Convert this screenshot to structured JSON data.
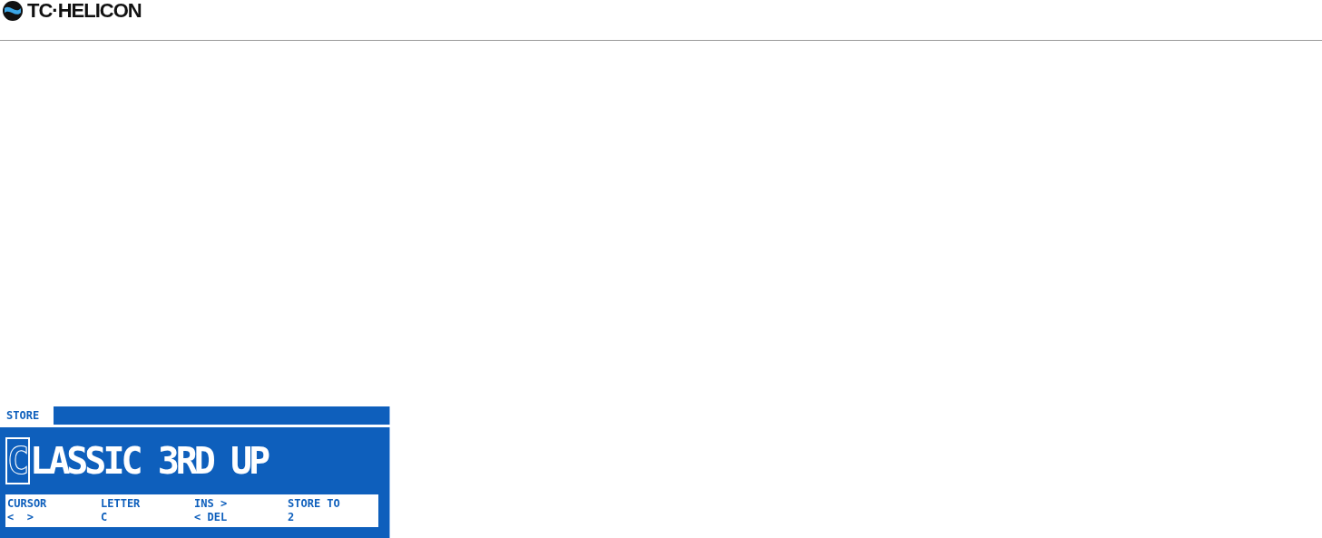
{
  "header": {
    "logo_text": "TC·HELICON"
  },
  "display": {
    "tab": "STORE",
    "name": {
      "selected_part": "C",
      "rest": "LASSIC 3RD UP"
    },
    "columns": [
      {
        "label": "CURSOR",
        "value": "<  >"
      },
      {
        "label": "LETTER",
        "value": "C"
      },
      {
        "label": "INS >",
        "value": "< DEL"
      },
      {
        "label": "STORE TO",
        "value": "2"
      }
    ]
  }
}
